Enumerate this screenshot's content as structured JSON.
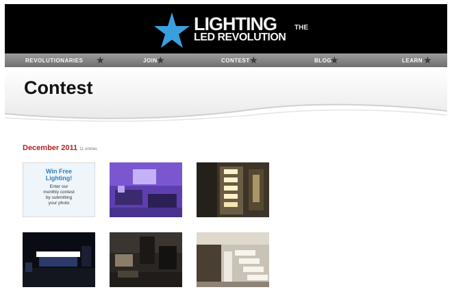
{
  "logo": {
    "line1": "LIGHTING",
    "the": "THE",
    "line2": "LED REVOLUTION"
  },
  "nav": {
    "items": [
      "REVOLUTIONARIES",
      "JOIN",
      "CONTEST",
      "BLOG",
      "LEARN"
    ]
  },
  "page_title": "Contest",
  "section": {
    "month": "December 2011",
    "entries": "11 entries"
  },
  "promo": {
    "headline_1": "Win Free",
    "headline_2": "Lighting!",
    "body_1": "Enter our",
    "body_2": "monthly contest",
    "body_3": "by submitting",
    "body_4": "your photo"
  },
  "thumbnails": [
    "promo-tile",
    "purple-lit-room-photo",
    "wall-sconces-photo",
    "night-storefront-photo",
    "dark-living-room-photo",
    "stair-lighting-photo"
  ],
  "colors": {
    "header_bg": "#000000",
    "nav_bg": "#8a8a8a",
    "star_blue": "#3aa0dd",
    "month_red": "#b22222",
    "promo_blue": "#2a7fc0"
  }
}
